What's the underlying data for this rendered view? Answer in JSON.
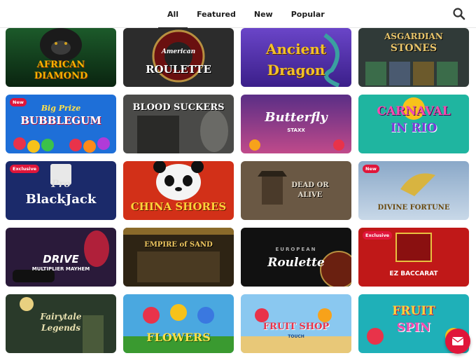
{
  "tabs": [
    {
      "label": "All"
    },
    {
      "label": "Featured"
    },
    {
      "label": "New"
    },
    {
      "label": "Popular"
    }
  ],
  "games": [
    {
      "title": "AFRICAN",
      "title2": "DIAMOND",
      "badge": ""
    },
    {
      "title": "American",
      "title2": "ROULETTE",
      "badge": ""
    },
    {
      "title": "Ancient",
      "title2": "Dragon",
      "badge": ""
    },
    {
      "title": "ASGARDIAN",
      "title2": "STONES",
      "badge": ""
    },
    {
      "title": "Big Prize",
      "title2": "BUBBLEGUM",
      "badge": "New"
    },
    {
      "title": "BLOOD SUCKERS",
      "title2": "",
      "badge": ""
    },
    {
      "title": "Butterfly",
      "title2": "STAXX",
      "badge": ""
    },
    {
      "title": "CARNAVAL",
      "title2": "IN RIO",
      "badge": ""
    },
    {
      "title": "Pro",
      "title2": "BlackJack",
      "badge": "Exclusive"
    },
    {
      "title": "CHINA SHORES",
      "title2": "",
      "badge": ""
    },
    {
      "title": "DEAD OR",
      "title2": "ALIVE",
      "badge": ""
    },
    {
      "title": "DIVINE FORTUNE",
      "title2": "",
      "badge": "New"
    },
    {
      "title": "DRIVE",
      "title2": "MULTIPLIER MAYHEM",
      "badge": ""
    },
    {
      "title": "EMPIRE of SAND",
      "title2": "",
      "badge": ""
    },
    {
      "title": "EUROPEAN",
      "title2": "Roulette",
      "badge": ""
    },
    {
      "title": "EZ BACCARAT",
      "title2": "",
      "badge": "Exclusive"
    },
    {
      "title": "Fairytale",
      "title2": "Legends",
      "badge": ""
    },
    {
      "title": "FLOWERS",
      "title2": "",
      "badge": ""
    },
    {
      "title": "FRUIT SHOP",
      "title2": "TOUCH",
      "badge": ""
    },
    {
      "title": "FRUIT",
      "title2": "SPIN",
      "badge": ""
    }
  ]
}
